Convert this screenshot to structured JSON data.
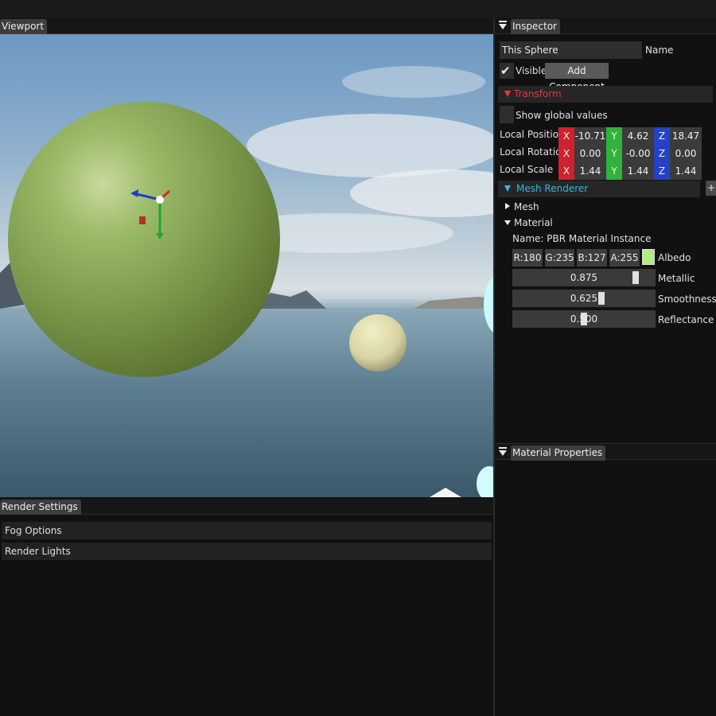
{
  "viewport": {
    "tab_label": "Viewport"
  },
  "render_settings": {
    "tab_label": "Render Settings",
    "sections": [
      {
        "label": "Fog Options"
      },
      {
        "label": "Render Lights"
      }
    ]
  },
  "inspector": {
    "tab_label": "Inspector",
    "name_value": "This Sphere",
    "name_label": "Name",
    "visible_label": "Visible",
    "visible_checked": true,
    "add_component_label": "Add Component",
    "transform": {
      "header": "Transform",
      "show_global_label": "Show global values",
      "rows": [
        {
          "label": "Local Position",
          "x": "-10.71",
          "y": "4.62",
          "z": "18.47"
        },
        {
          "label": "Local Rotation",
          "x": "0.00",
          "y": "-0.00",
          "z": "0.00"
        },
        {
          "label": "Local Scale",
          "x": "1.44",
          "y": "1.44",
          "z": "1.44"
        }
      ],
      "axis_x": "X",
      "axis_y": "Y",
      "axis_z": "Z"
    },
    "mesh_renderer": {
      "header": "Mesh Renderer",
      "plus_label": "+",
      "mesh_label": "Mesh",
      "material_label": "Material",
      "material_name": "Name: PBR Material Instance",
      "albedo": {
        "r": "R:180",
        "g": "G:235",
        "b": "B:127",
        "a": "A:255",
        "label": "Albedo",
        "color": "#b4eb7f"
      },
      "sliders": [
        {
          "value_text": "0.875",
          "value": 0.875,
          "label": "Metallic"
        },
        {
          "value_text": "0.625",
          "value": 0.625,
          "label": "Smoothness"
        },
        {
          "value_text": "0.500",
          "value": 0.5,
          "label": "Reflectance"
        }
      ]
    }
  },
  "material_properties": {
    "tab_label": "Material Properties"
  },
  "colors": {
    "axis_x": "#d0212e",
    "axis_y": "#2fb33a",
    "axis_z": "#2541c9",
    "transform_accent": "#e03c3c",
    "mesh_renderer_accent": "#38b4e8"
  }
}
